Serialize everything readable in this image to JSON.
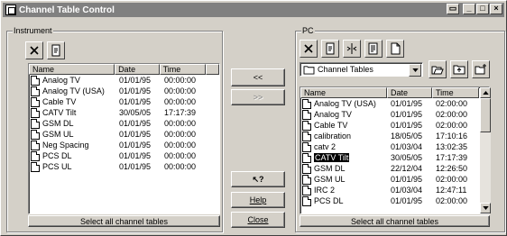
{
  "window": {
    "title": "Channel Table Control",
    "controls": [
      "restore-icon",
      "minimize-icon",
      "maximize-icon",
      "close-icon"
    ]
  },
  "instrument": {
    "legend": "Instrument",
    "columns": [
      "Name",
      "Date",
      "Time"
    ],
    "rows": [
      {
        "name": "Analog TV",
        "date": "01/01/95",
        "time": "00:00:00"
      },
      {
        "name": "Analog TV (USA)",
        "date": "01/01/95",
        "time": "00:00:00"
      },
      {
        "name": "Cable TV",
        "date": "01/01/95",
        "time": "00:00:00"
      },
      {
        "name": "CATV Tilt",
        "date": "30/05/05",
        "time": "17:17:39"
      },
      {
        "name": "GSM DL",
        "date": "01/01/95",
        "time": "00:00:00"
      },
      {
        "name": "GSM UL",
        "date": "01/01/95",
        "time": "00:00:00"
      },
      {
        "name": "Neg Spacing",
        "date": "01/01/95",
        "time": "00:00:00"
      },
      {
        "name": "PCS DL",
        "date": "01/01/95",
        "time": "00:00:00"
      },
      {
        "name": "PCS UL",
        "date": "01/01/95",
        "time": "00:00:00"
      }
    ],
    "select_all": "Select all channel tables"
  },
  "middle": {
    "copy_to_instrument": "<<",
    "copy_to_pc": ">>",
    "whats_this": "?",
    "help": "Help",
    "close": "Close"
  },
  "pc": {
    "legend": "PC",
    "folder": "Channel Tables",
    "columns": [
      "Name",
      "Date",
      "Time"
    ],
    "rows": [
      {
        "name": "Analog TV (USA)",
        "date": "01/01/95",
        "time": "02:00:00"
      },
      {
        "name": "Analog TV",
        "date": "01/01/95",
        "time": "02:00:00"
      },
      {
        "name": "Cable TV",
        "date": "01/01/95",
        "time": "02:00:00"
      },
      {
        "name": "calibration",
        "date": "18/05/05",
        "time": "17:10:16"
      },
      {
        "name": "catv 2",
        "date": "01/03/04",
        "time": "13:02:35"
      },
      {
        "name": "CATV Tilt",
        "date": "30/05/05",
        "time": "17:17:39",
        "selected": true
      },
      {
        "name": "GSM DL",
        "date": "22/12/04",
        "time": "12:26:50"
      },
      {
        "name": "GSM UL",
        "date": "01/01/95",
        "time": "02:00:00"
      },
      {
        "name": "IRC 2",
        "date": "01/03/04",
        "time": "12:47:11"
      },
      {
        "name": "PCS DL",
        "date": "01/01/95",
        "time": "02:00:00"
      }
    ],
    "select_all": "Select all channel tables"
  }
}
